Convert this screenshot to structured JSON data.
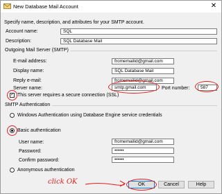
{
  "window": {
    "title": "New Database Mail Account",
    "close_glyph": "✕"
  },
  "intro": "Specify name, description, and attributes for your SMTP account.",
  "account": {
    "name_label": "Account name:",
    "name_value": "SQL",
    "description_label": "Description:",
    "description_value": "SQL Database Mail"
  },
  "outgoing": {
    "group_label": "Outgoing Mail Server (SMTP)",
    "email_label": "E-mail address:",
    "email_value": "fromemailid@gmail.com",
    "display_label": "Display name:",
    "display_value": "SQL Database Mail",
    "reply_label": "Reply e-mail:",
    "reply_value": "fromemailid@gmail.com",
    "server_label": "Server name:",
    "server_value": "smtp.gmail.com",
    "port_label": "Port number:",
    "port_value": "587",
    "ssl_label": "This server requires a secure connection (SSL)",
    "ssl_checked": "✓"
  },
  "auth": {
    "group_label": "SMTP Authentication",
    "windows_label": "Windows Authentication using Database Engine service credentials",
    "basic_label": "Basic authentication",
    "user_label": "User name:",
    "user_value": "fromemailid@gmail.com",
    "password_label": "Password:",
    "password_value": "••••••",
    "confirm_label": "Confirm password:",
    "confirm_value": "••••••",
    "anonymous_label": "Anonymous authentication"
  },
  "buttons": {
    "ok": "OK",
    "cancel": "Cancel",
    "help": "Help"
  },
  "annotation": {
    "text": "click OK",
    "color": "#e02020"
  }
}
